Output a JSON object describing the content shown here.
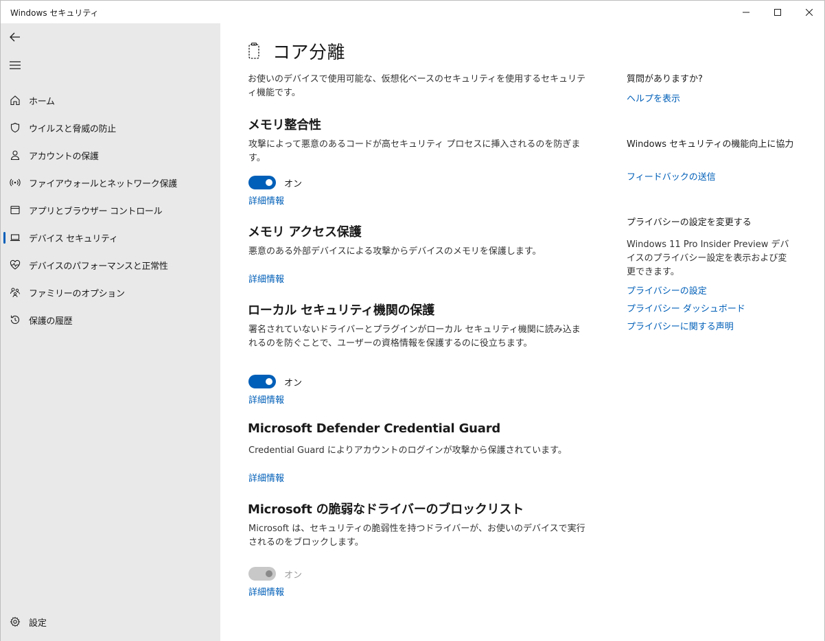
{
  "window": {
    "title": "Windows セキュリティ"
  },
  "sidebar": {
    "items": [
      {
        "label": "ホーム",
        "icon": "home-icon"
      },
      {
        "label": "ウイルスと脅威の防止",
        "icon": "shield-icon"
      },
      {
        "label": "アカウントの保護",
        "icon": "person-icon"
      },
      {
        "label": "ファイアウォールとネットワーク保護",
        "icon": "wireless-icon"
      },
      {
        "label": "アプリとブラウザー コントロール",
        "icon": "app-window-icon"
      },
      {
        "label": "デバイス セキュリティ",
        "icon": "laptop-icon"
      },
      {
        "label": "デバイスのパフォーマンスと正常性",
        "icon": "heart-pulse-icon"
      },
      {
        "label": "ファミリーのオプション",
        "icon": "family-icon"
      },
      {
        "label": "保護の履歴",
        "icon": "history-icon"
      }
    ],
    "active_index": 5,
    "settings_label": "設定"
  },
  "main": {
    "title": "コア分離",
    "description": "お使いのデバイスで使用可能な、仮想化ベースのセキュリティを使用するセキュリティ機能です。",
    "sections": {
      "memory_integrity": {
        "title": "メモリ整合性",
        "description": "攻撃によって悪意のあるコードが高セキュリティ プロセスに挿入されるのを防ぎます。",
        "toggle_label": "オン",
        "toggle_on": true,
        "link": "詳細情報"
      },
      "memory_access": {
        "title": "メモリ アクセス保護",
        "description": "悪意のある外部デバイスによる攻撃からデバイスのメモリを保護します。",
        "link": "詳細情報"
      },
      "lsa": {
        "title": "ローカル セキュリティ機関の保護",
        "description": "署名されていないドライバーとプラグインがローカル セキュリティ機関に読み込まれるのを防ぐことで、ユーザーの資格情報を保護するのに役立ちます。",
        "toggle_label": "オン",
        "toggle_on": true,
        "link": "詳細情報"
      },
      "credential_guard": {
        "title": "Microsoft Defender Credential Guard",
        "description": "Credential Guard によりアカウントのログインが攻撃から保護されています。",
        "link": "詳細情報"
      },
      "driver_blocklist": {
        "title": "Microsoft の脆弱なドライバーのブロックリスト",
        "description": "Microsoft は、セキュリティの脆弱性を持つドライバーが、お使いのデバイスで実行されるのをブロックします。",
        "toggle_label": "オン",
        "toggle_on": true,
        "toggle_disabled": true,
        "link": "詳細情報"
      }
    }
  },
  "right": {
    "question_heading": "質問がありますか?",
    "help_link": "ヘルプを表示",
    "improve_heading": "Windows セキュリティの機能向上に協力",
    "feedback_link": "フィードバックの送信",
    "privacy_heading": "プライバシーの設定を変更する",
    "privacy_text": "Windows 11 Pro Insider Preview デバイスのプライバシー設定を表示および変更できます。",
    "privacy_links": [
      "プライバシーの設定",
      "プライバシー ダッシュボード",
      "プライバシーに関する声明"
    ]
  },
  "colors": {
    "accent": "#005fb8",
    "sidebar_bg": "#e9e9e9",
    "disabled": "#c8c8c8"
  }
}
